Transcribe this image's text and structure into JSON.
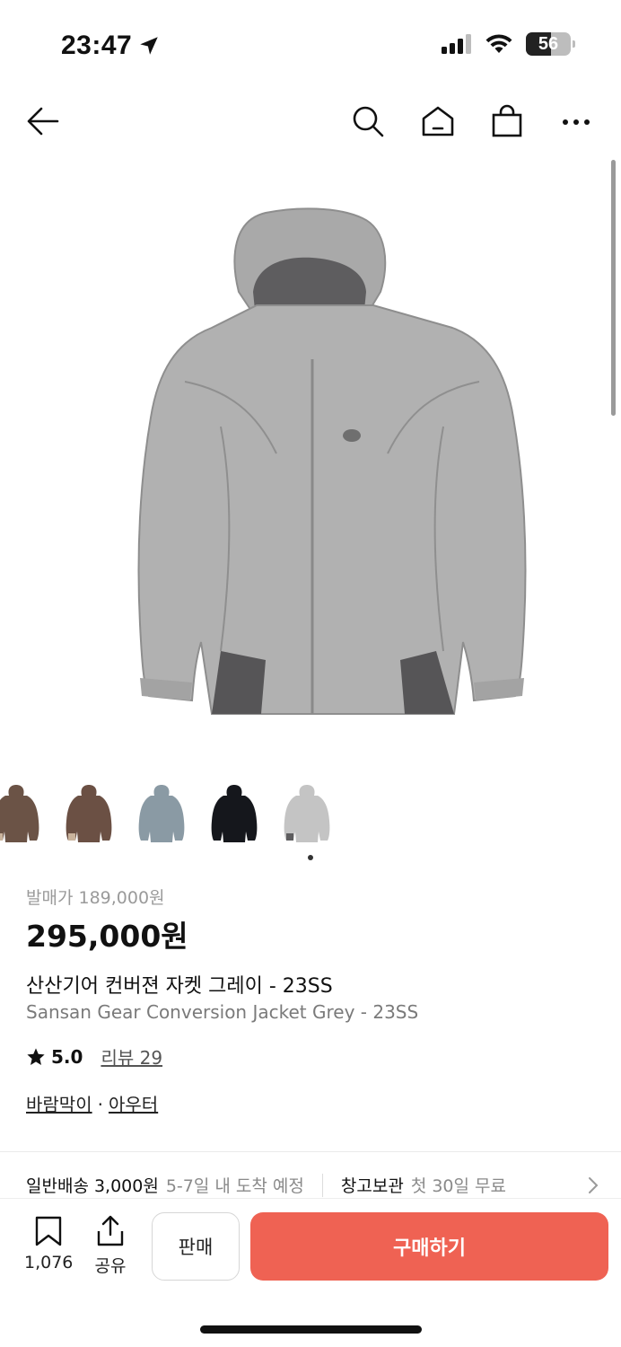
{
  "status_bar": {
    "time": "23:47",
    "battery": "56",
    "battery_level": 0.56
  },
  "nav": {
    "back_icon": "arrow-left-icon",
    "search_icon": "search-icon",
    "home_icon": "home-icon",
    "cart_icon": "shopping-bag-icon",
    "more_icon": "more-dots-icon"
  },
  "product": {
    "original_price": "발매가 189,000원",
    "price": "295,000원",
    "title_ko": "산산기어 컨버젼 자켓 그레이 - 23SS",
    "title_en": "Sansan Gear Conversion Jacket Grey - 23SS",
    "rating": "5.0",
    "review_label": "리뷰 29",
    "categories": [
      "바람막이",
      "아우터"
    ],
    "category_separator": "·",
    "thumbnail_colors": [
      "#6b5346",
      "#6b5044",
      "#8a9aa4",
      "#15171c",
      "#c4c4c4"
    ],
    "selected_thumbnail_index": 4
  },
  "shipping": {
    "standard": "일반배송 3,000원",
    "standard_eta": "5-7일 내 도착 예정",
    "storage": "창고보관",
    "storage_note": "첫 30일 무료"
  },
  "bottom_bar": {
    "bookmark_count": "1,076",
    "share_label": "공유",
    "sell_label": "판매",
    "buy_label": "구매하기"
  },
  "colors": {
    "buy_button": "#ef6253",
    "text_primary": "#111111",
    "text_muted": "#8a8a8a"
  }
}
